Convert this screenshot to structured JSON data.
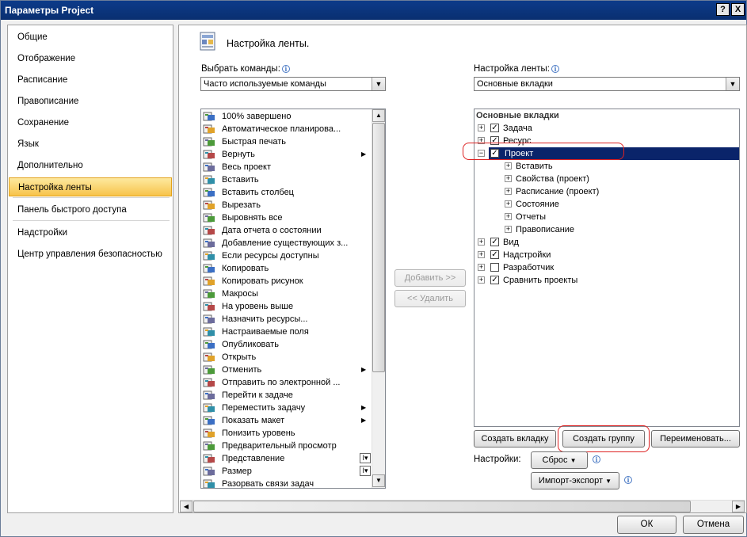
{
  "window": {
    "title": "Параметры Project",
    "help_glyph": "?",
    "close_glyph": "X"
  },
  "nav": {
    "items": [
      {
        "label": "Общие"
      },
      {
        "label": "Отображение"
      },
      {
        "label": "Расписание"
      },
      {
        "label": "Правописание"
      },
      {
        "label": "Сохранение"
      },
      {
        "label": "Язык"
      },
      {
        "label": "Дополнительно"
      },
      {
        "label": "Настройка ленты",
        "active": true
      },
      {
        "label": "Панель быстрого доступа"
      },
      {
        "label": "Надстройки"
      },
      {
        "label": "Центр управления безопасностью"
      }
    ]
  },
  "header": {
    "title": "Настройка ленты."
  },
  "left_panel": {
    "label": "Выбрать команды:",
    "combo_value": "Часто используемые команды",
    "commands": [
      {
        "label": "100% завершено",
        "icon": "percent-complete-icon"
      },
      {
        "label": "Автоматическое планирова...",
        "icon": "auto-schedule-icon"
      },
      {
        "label": "Быстрая печать",
        "icon": "quick-print-icon"
      },
      {
        "label": "Вернуть",
        "icon": "redo-icon",
        "submenu": true
      },
      {
        "label": "Весь проект",
        "icon": "whole-project-icon"
      },
      {
        "label": "Вставить",
        "icon": "paste-icon"
      },
      {
        "label": "Вставить столбец",
        "icon": "insert-column-icon"
      },
      {
        "label": "Вырезать",
        "icon": "cut-icon"
      },
      {
        "label": "Выровнять все",
        "icon": "level-all-icon"
      },
      {
        "label": "Дата отчета о состоянии",
        "icon": "status-date-icon"
      },
      {
        "label": "Добавление существующих з...",
        "icon": "add-existing-icon"
      },
      {
        "label": "Если ресурсы доступны",
        "icon": "resources-available-icon"
      },
      {
        "label": "Копировать",
        "icon": "copy-icon"
      },
      {
        "label": "Копировать рисунок",
        "icon": "copy-picture-icon"
      },
      {
        "label": "Макросы",
        "icon": "macros-icon"
      },
      {
        "label": "На уровень выше",
        "icon": "outdent-icon"
      },
      {
        "label": "Назначить ресурсы...",
        "icon": "assign-resources-icon"
      },
      {
        "label": "Настраиваемые поля",
        "icon": "custom-fields-icon"
      },
      {
        "label": "Опубликовать",
        "icon": "publish-icon"
      },
      {
        "label": "Открыть",
        "icon": "open-icon"
      },
      {
        "label": "Отменить",
        "icon": "undo-icon",
        "submenu": true
      },
      {
        "label": "Отправить по электронной ...",
        "icon": "send-email-icon"
      },
      {
        "label": "Перейти к задаче",
        "icon": "goto-task-icon"
      },
      {
        "label": "Переместить задачу",
        "icon": "move-task-icon",
        "submenu": true
      },
      {
        "label": "Показать макет",
        "icon": "show-layout-icon",
        "submenu": true
      },
      {
        "label": "Понизить уровень",
        "icon": "indent-icon"
      },
      {
        "label": "Предварительный просмотр",
        "icon": "print-preview-icon"
      },
      {
        "label": "Представление",
        "icon": "view-icon",
        "dropdown": true
      },
      {
        "label": "Размер",
        "icon": "size-icon",
        "dropdown": true
      },
      {
        "label": "Разорвать связи задач",
        "icon": "unlink-tasks-icon"
      }
    ]
  },
  "middle": {
    "add_label": "Добавить >>",
    "remove_label": "<< Удалить"
  },
  "right_panel": {
    "label": "Настройка ленты:",
    "combo_value": "Основные вкладки",
    "tree_header": "Основные вкладки",
    "tree": [
      {
        "label": "Задача",
        "level": 0,
        "expander": "+",
        "checked": true
      },
      {
        "label": "Ресурс",
        "level": 0,
        "expander": "+",
        "checked": true
      },
      {
        "label": "Проект",
        "level": 0,
        "expander": "-",
        "checked": true,
        "selected": true
      },
      {
        "label": "Вставить",
        "level": 1,
        "expander": "+"
      },
      {
        "label": "Свойства (проект)",
        "level": 1,
        "expander": "+"
      },
      {
        "label": "Расписание (проект)",
        "level": 1,
        "expander": "+"
      },
      {
        "label": "Состояние",
        "level": 1,
        "expander": "+"
      },
      {
        "label": "Отчеты",
        "level": 1,
        "expander": "+"
      },
      {
        "label": "Правописание",
        "level": 1,
        "expander": "+"
      },
      {
        "label": "Вид",
        "level": 0,
        "expander": "+",
        "checked": true
      },
      {
        "label": "Надстройки",
        "level": 0,
        "expander": "+",
        "checked": true
      },
      {
        "label": "Разработчик",
        "level": 0,
        "expander": "+",
        "checked": false
      },
      {
        "label": "Сравнить проекты",
        "level": 0,
        "expander": "+",
        "checked": true
      }
    ],
    "new_tab_label": "Создать вкладку",
    "new_group_label": "Создать группу",
    "rename_label": "Переименовать...",
    "settings_label": "Настройки:",
    "reset_label": "Сброс",
    "import_export_label": "Импорт-экспорт"
  },
  "footer": {
    "ok_label": "ОК",
    "cancel_label": "Отмена"
  },
  "colors": {
    "title_bar": "#0a2f70",
    "selected_row": "#0a246a",
    "active_nav": "#f7c34a",
    "highlight_ring": "#dd2222"
  }
}
